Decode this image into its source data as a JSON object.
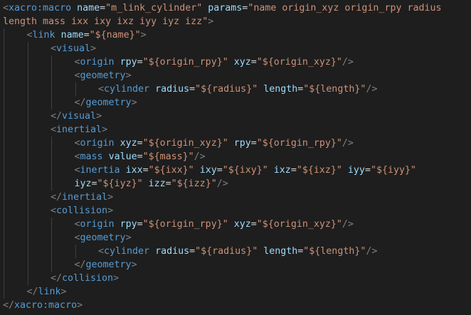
{
  "colors": {
    "background": "#1e1e1e",
    "tag": "#569cd6",
    "attribute": "#9cdcfe",
    "string": "#ce9178",
    "punctuation": "#808080",
    "text": "#d4d4d4",
    "indent_guide": "#404040"
  },
  "lines": [
    {
      "indent": 0,
      "tokens": [
        {
          "t": "punct",
          "v": "<"
        },
        {
          "t": "tag",
          "v": "xacro:macro"
        },
        {
          "t": "txt",
          "v": " "
        },
        {
          "t": "attr",
          "v": "name"
        },
        {
          "t": "txt",
          "v": "="
        },
        {
          "t": "str",
          "v": "\"m_link_cylinder\""
        },
        {
          "t": "txt",
          "v": " "
        },
        {
          "t": "attr",
          "v": "params"
        },
        {
          "t": "txt",
          "v": "="
        },
        {
          "t": "str",
          "v": "\"name origin_xyz origin_rpy radius"
        }
      ]
    },
    {
      "indent": 0,
      "tokens": [
        {
          "t": "str",
          "v": "length mass ixx ixy ixz iyy iyz izz\""
        },
        {
          "t": "punct",
          "v": ">"
        }
      ]
    },
    {
      "indent": 1,
      "tokens": [
        {
          "t": "punct",
          "v": "<"
        },
        {
          "t": "tag",
          "v": "link"
        },
        {
          "t": "txt",
          "v": " "
        },
        {
          "t": "attr",
          "v": "name"
        },
        {
          "t": "txt",
          "v": "="
        },
        {
          "t": "str",
          "v": "\"${name}\""
        },
        {
          "t": "punct",
          "v": ">"
        }
      ]
    },
    {
      "indent": 2,
      "tokens": [
        {
          "t": "punct",
          "v": "<"
        },
        {
          "t": "tag",
          "v": "visual"
        },
        {
          "t": "punct",
          "v": ">"
        }
      ]
    },
    {
      "indent": 3,
      "tokens": [
        {
          "t": "punct",
          "v": "<"
        },
        {
          "t": "tag",
          "v": "origin"
        },
        {
          "t": "txt",
          "v": " "
        },
        {
          "t": "attr",
          "v": "rpy"
        },
        {
          "t": "txt",
          "v": "="
        },
        {
          "t": "str",
          "v": "\"${origin_rpy}\""
        },
        {
          "t": "txt",
          "v": " "
        },
        {
          "t": "attr",
          "v": "xyz"
        },
        {
          "t": "txt",
          "v": "="
        },
        {
          "t": "str",
          "v": "\"${origin_xyz}\""
        },
        {
          "t": "punct",
          "v": "/>"
        }
      ]
    },
    {
      "indent": 3,
      "tokens": [
        {
          "t": "punct",
          "v": "<"
        },
        {
          "t": "tag",
          "v": "geometry"
        },
        {
          "t": "punct",
          "v": ">"
        }
      ]
    },
    {
      "indent": 4,
      "tokens": [
        {
          "t": "punct",
          "v": "<"
        },
        {
          "t": "tag",
          "v": "cylinder"
        },
        {
          "t": "txt",
          "v": " "
        },
        {
          "t": "attr",
          "v": "radius"
        },
        {
          "t": "txt",
          "v": "="
        },
        {
          "t": "str",
          "v": "\"${radius}\""
        },
        {
          "t": "txt",
          "v": " "
        },
        {
          "t": "attr",
          "v": "length"
        },
        {
          "t": "txt",
          "v": "="
        },
        {
          "t": "str",
          "v": "\"${length}\""
        },
        {
          "t": "punct",
          "v": "/>"
        }
      ]
    },
    {
      "indent": 3,
      "tokens": [
        {
          "t": "punct",
          "v": "</"
        },
        {
          "t": "tag",
          "v": "geometry"
        },
        {
          "t": "punct",
          "v": ">"
        }
      ]
    },
    {
      "indent": 2,
      "tokens": [
        {
          "t": "punct",
          "v": "</"
        },
        {
          "t": "tag",
          "v": "visual"
        },
        {
          "t": "punct",
          "v": ">"
        }
      ]
    },
    {
      "indent": 2,
      "tokens": [
        {
          "t": "punct",
          "v": "<"
        },
        {
          "t": "tag",
          "v": "inertial"
        },
        {
          "t": "punct",
          "v": ">"
        }
      ]
    },
    {
      "indent": 3,
      "tokens": [
        {
          "t": "punct",
          "v": "<"
        },
        {
          "t": "tag",
          "v": "origin"
        },
        {
          "t": "txt",
          "v": " "
        },
        {
          "t": "attr",
          "v": "xyz"
        },
        {
          "t": "txt",
          "v": "="
        },
        {
          "t": "str",
          "v": "\"${origin_xyz}\""
        },
        {
          "t": "txt",
          "v": " "
        },
        {
          "t": "attr",
          "v": "rpy"
        },
        {
          "t": "txt",
          "v": "="
        },
        {
          "t": "str",
          "v": "\"${origin_rpy}\""
        },
        {
          "t": "punct",
          "v": "/>"
        }
      ]
    },
    {
      "indent": 3,
      "tokens": [
        {
          "t": "punct",
          "v": "<"
        },
        {
          "t": "tag",
          "v": "mass"
        },
        {
          "t": "txt",
          "v": " "
        },
        {
          "t": "attr",
          "v": "value"
        },
        {
          "t": "txt",
          "v": "="
        },
        {
          "t": "str",
          "v": "\"${mass}\""
        },
        {
          "t": "punct",
          "v": "/>"
        }
      ]
    },
    {
      "indent": 3,
      "tokens": [
        {
          "t": "punct",
          "v": "<"
        },
        {
          "t": "tag",
          "v": "inertia"
        },
        {
          "t": "txt",
          "v": " "
        },
        {
          "t": "attr",
          "v": "ixx"
        },
        {
          "t": "txt",
          "v": "="
        },
        {
          "t": "str",
          "v": "\"${ixx}\""
        },
        {
          "t": "txt",
          "v": " "
        },
        {
          "t": "attr",
          "v": "ixy"
        },
        {
          "t": "txt",
          "v": "="
        },
        {
          "t": "str",
          "v": "\"${ixy}\""
        },
        {
          "t": "txt",
          "v": " "
        },
        {
          "t": "attr",
          "v": "ixz"
        },
        {
          "t": "txt",
          "v": "="
        },
        {
          "t": "str",
          "v": "\"${ixz}\""
        },
        {
          "t": "txt",
          "v": " "
        },
        {
          "t": "attr",
          "v": "iyy"
        },
        {
          "t": "txt",
          "v": "="
        },
        {
          "t": "str",
          "v": "\"${iyy}\""
        }
      ]
    },
    {
      "indent": 3,
      "tokens": [
        {
          "t": "attr",
          "v": "iyz"
        },
        {
          "t": "txt",
          "v": "="
        },
        {
          "t": "str",
          "v": "\"${iyz}\""
        },
        {
          "t": "txt",
          "v": " "
        },
        {
          "t": "attr",
          "v": "izz"
        },
        {
          "t": "txt",
          "v": "="
        },
        {
          "t": "str",
          "v": "\"${izz}\""
        },
        {
          "t": "punct",
          "v": "/>"
        }
      ]
    },
    {
      "indent": 2,
      "tokens": [
        {
          "t": "punct",
          "v": "</"
        },
        {
          "t": "tag",
          "v": "inertial"
        },
        {
          "t": "punct",
          "v": ">"
        }
      ]
    },
    {
      "indent": 2,
      "tokens": [
        {
          "t": "punct",
          "v": "<"
        },
        {
          "t": "tag",
          "v": "collision"
        },
        {
          "t": "punct",
          "v": ">"
        }
      ]
    },
    {
      "indent": 3,
      "tokens": [
        {
          "t": "punct",
          "v": "<"
        },
        {
          "t": "tag",
          "v": "origin"
        },
        {
          "t": "txt",
          "v": " "
        },
        {
          "t": "attr",
          "v": "rpy"
        },
        {
          "t": "txt",
          "v": "="
        },
        {
          "t": "str",
          "v": "\"${origin_rpy}\""
        },
        {
          "t": "txt",
          "v": " "
        },
        {
          "t": "attr",
          "v": "xyz"
        },
        {
          "t": "txt",
          "v": "="
        },
        {
          "t": "str",
          "v": "\"${origin_xyz}\""
        },
        {
          "t": "punct",
          "v": "/>"
        }
      ]
    },
    {
      "indent": 3,
      "tokens": [
        {
          "t": "punct",
          "v": "<"
        },
        {
          "t": "tag",
          "v": "geometry"
        },
        {
          "t": "punct",
          "v": ">"
        }
      ]
    },
    {
      "indent": 4,
      "tokens": [
        {
          "t": "punct",
          "v": "<"
        },
        {
          "t": "tag",
          "v": "cylinder"
        },
        {
          "t": "txt",
          "v": " "
        },
        {
          "t": "attr",
          "v": "radius"
        },
        {
          "t": "txt",
          "v": "="
        },
        {
          "t": "str",
          "v": "\"${radius}\""
        },
        {
          "t": "txt",
          "v": " "
        },
        {
          "t": "attr",
          "v": "length"
        },
        {
          "t": "txt",
          "v": "="
        },
        {
          "t": "str",
          "v": "\"${length}\""
        },
        {
          "t": "punct",
          "v": "/>"
        }
      ]
    },
    {
      "indent": 3,
      "tokens": [
        {
          "t": "punct",
          "v": "</"
        },
        {
          "t": "tag",
          "v": "geometry"
        },
        {
          "t": "punct",
          "v": ">"
        }
      ]
    },
    {
      "indent": 2,
      "tokens": [
        {
          "t": "punct",
          "v": "</"
        },
        {
          "t": "tag",
          "v": "collision"
        },
        {
          "t": "punct",
          "v": ">"
        }
      ]
    },
    {
      "indent": 1,
      "tokens": [
        {
          "t": "punct",
          "v": "</"
        },
        {
          "t": "tag",
          "v": "link"
        },
        {
          "t": "punct",
          "v": ">"
        }
      ]
    },
    {
      "indent": 0,
      "tokens": [
        {
          "t": "punct",
          "v": "</"
        },
        {
          "t": "tag",
          "v": "xacro:macro"
        },
        {
          "t": "punct",
          "v": ">"
        }
      ]
    }
  ]
}
